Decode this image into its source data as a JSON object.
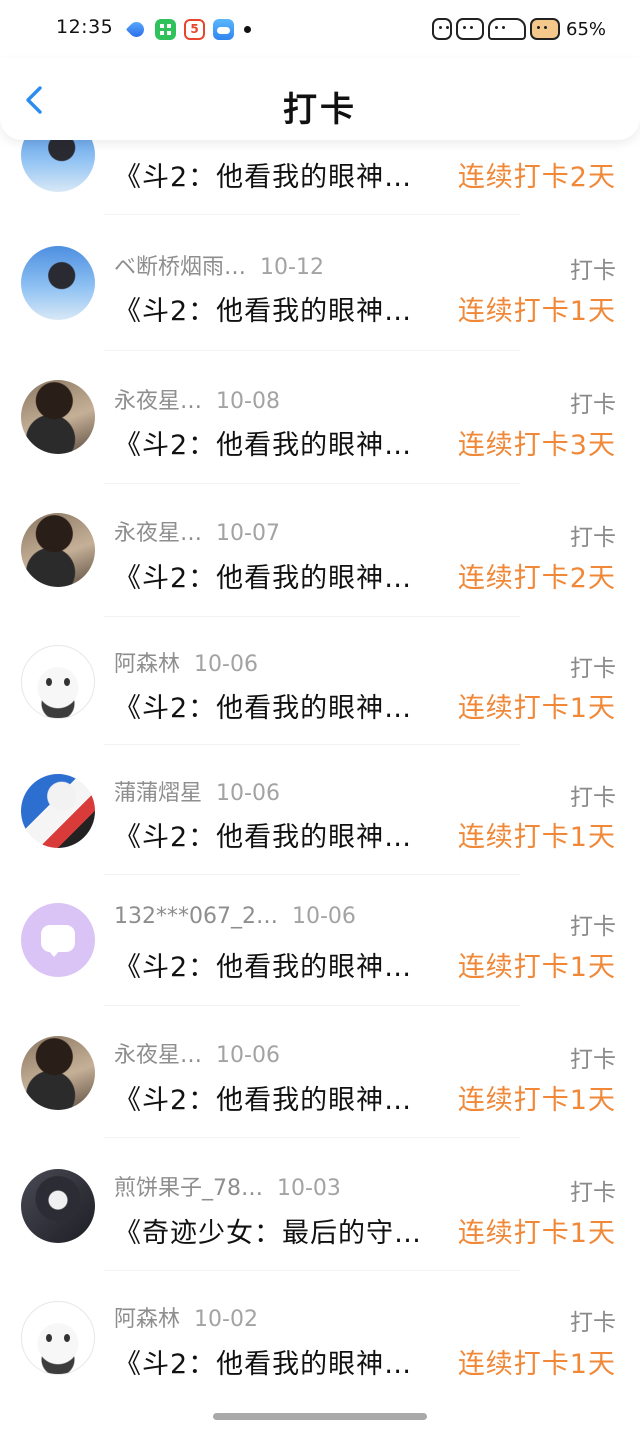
{
  "status_bar": {
    "time": "12:35",
    "notification_icons": [
      "browser-app-icon",
      "spreadsheet-app-icon",
      "html5-app-icon",
      "weather-app-icon"
    ],
    "battery": "65%"
  },
  "nav": {
    "title": "打卡",
    "back_icon": "chevron-left-icon"
  },
  "colors": {
    "accent": "#f08838",
    "back_arrow": "#2b8cf0"
  },
  "items": [
    {
      "name": "",
      "date": "",
      "tag": "",
      "work": "《斗2：他看我的眼神…",
      "streak": "连续打卡2天",
      "avatar": "sky"
    },
    {
      "name": "ベ断桥烟雨…",
      "date": "10-12",
      "tag": "打卡",
      "work": "《斗2：他看我的眼神…",
      "streak": "连续打卡1天",
      "avatar": "sky"
    },
    {
      "name": "永夜星…",
      "date": "10-08",
      "tag": "打卡",
      "work": "《斗2：他看我的眼神…",
      "streak": "连续打卡3天",
      "avatar": "girl"
    },
    {
      "name": "永夜星…",
      "date": "10-07",
      "tag": "打卡",
      "work": "《斗2：他看我的眼神…",
      "streak": "连续打卡2天",
      "avatar": "girl"
    },
    {
      "name": "阿森林",
      "date": "10-06",
      "tag": "打卡",
      "work": "《斗2：他看我的眼神…",
      "streak": "连续打卡1天",
      "avatar": "chibi"
    },
    {
      "name": "蒲蒲熠星",
      "date": "10-06",
      "tag": "打卡",
      "work": "《斗2：他看我的眼神…",
      "streak": "连续打卡1天",
      "avatar": "anime"
    },
    {
      "name": "132***067_2…",
      "date": "10-06",
      "tag": "打卡",
      "work": "《斗2：他看我的眼神…",
      "streak": "连续打卡1天",
      "avatar": "default"
    },
    {
      "name": "永夜星…",
      "date": "10-06",
      "tag": "打卡",
      "work": "《斗2：他看我的眼神…",
      "streak": "连续打卡1天",
      "avatar": "girl"
    },
    {
      "name": "煎饼果子_78…",
      "date": "10-03",
      "tag": "打卡",
      "work": "《奇迹少女：最后的守…",
      "streak": "连续打卡1天",
      "avatar": "dark"
    },
    {
      "name": "阿森林",
      "date": "10-02",
      "tag": "打卡",
      "work": "《斗2：他看我的眼神…",
      "streak": "连续打卡1天",
      "avatar": "chibi"
    }
  ]
}
